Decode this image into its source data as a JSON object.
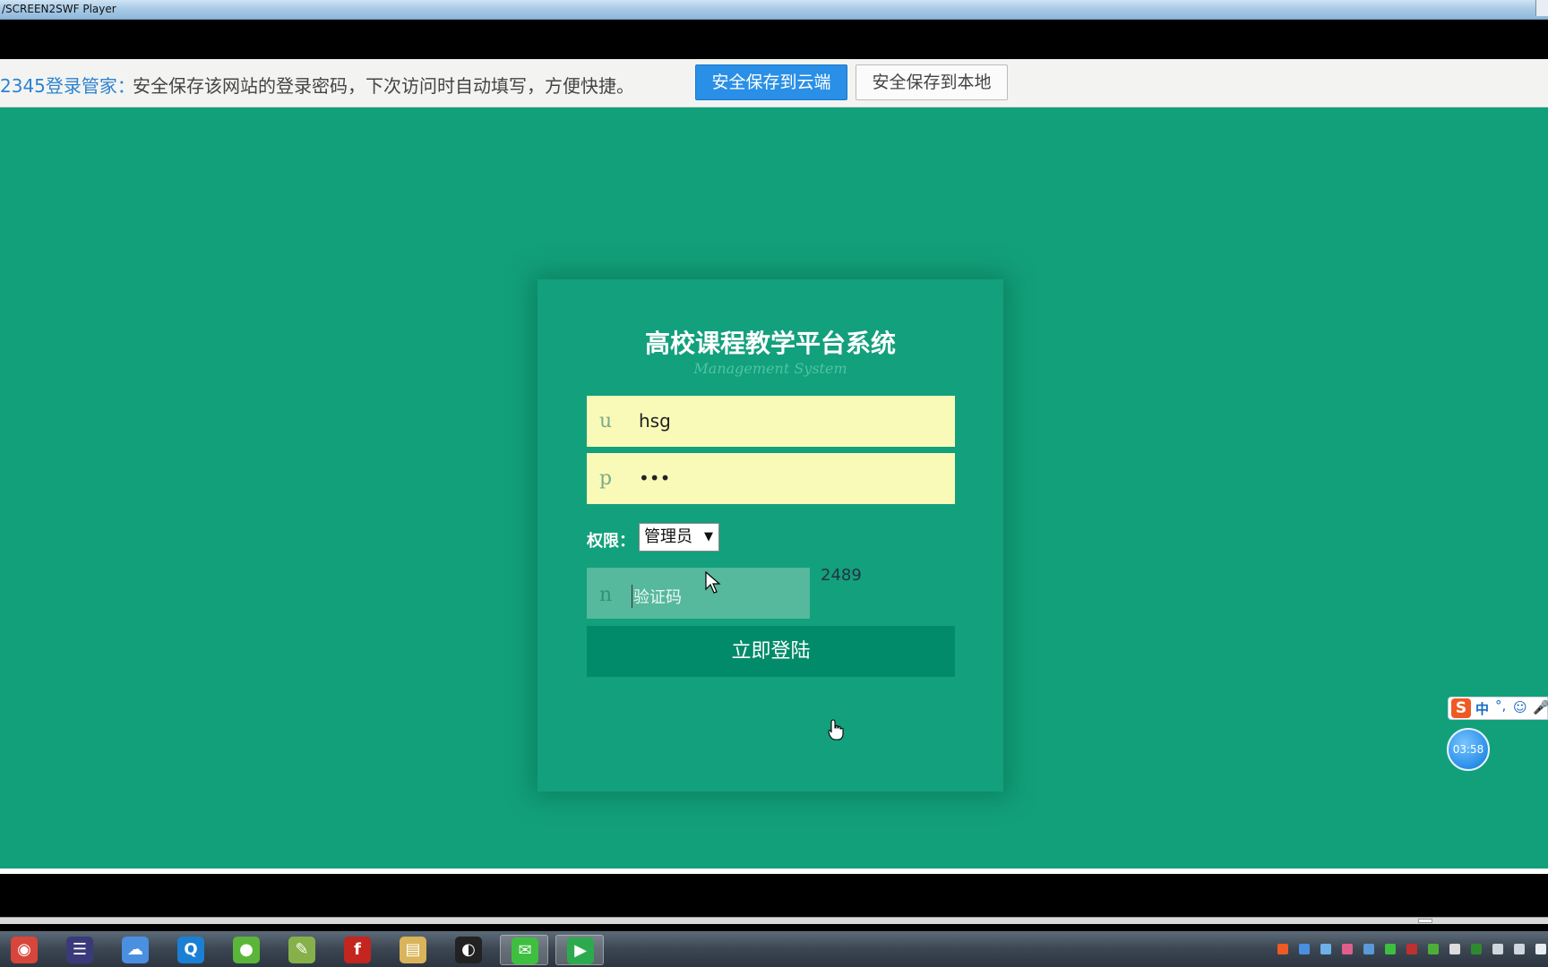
{
  "window": {
    "title": "/SCREEN2SWF Player"
  },
  "password_manager": {
    "brand": "2345登录管家：",
    "message": "安全保存该网站的登录密码，下次访问时自动填写，方便快捷。",
    "save_cloud_label": "安全保存到云端",
    "save_local_label": "安全保存到本地"
  },
  "login": {
    "title": "高校课程教学平台系统",
    "subtitle": "Management System",
    "username": {
      "prefix": "u",
      "value": "hsg"
    },
    "password": {
      "prefix": "p",
      "value": "•••"
    },
    "role": {
      "label": "权限：",
      "selected": "管理员"
    },
    "captcha": {
      "prefix": "n",
      "placeholder": "验证码",
      "code": "2489"
    },
    "submit_label": "立即登陆"
  },
  "ime": {
    "lang": "中",
    "punct": "°,",
    "emoji": "☺",
    "mic": "🎤"
  },
  "timer": {
    "text": "03:58"
  },
  "taskbar": {
    "apps": [
      {
        "name": "chrome",
        "color": "#d8453a",
        "glyph": "◉"
      },
      {
        "name": "eclipse",
        "color": "#3a3a7a",
        "glyph": "☰"
      },
      {
        "name": "baidu-netdisk",
        "color": "#4a8fe0",
        "glyph": "☁"
      },
      {
        "name": "browser-q",
        "color": "#1b7fd4",
        "glyph": "Q"
      },
      {
        "name": "green-app",
        "color": "#5bb53a",
        "glyph": "●"
      },
      {
        "name": "notepad",
        "color": "#86b04a",
        "glyph": "✎"
      },
      {
        "name": "flash",
        "color": "#c4251f",
        "glyph": "f"
      },
      {
        "name": "file-explorer",
        "color": "#d9b45a",
        "glyph": "▤"
      },
      {
        "name": "qq",
        "color": "#222",
        "glyph": "◐"
      },
      {
        "name": "wechat",
        "color": "#3fbf3f",
        "glyph": "✉"
      },
      {
        "name": "screen-recorder",
        "color": "#2eaa4e",
        "glyph": "▶"
      }
    ]
  }
}
